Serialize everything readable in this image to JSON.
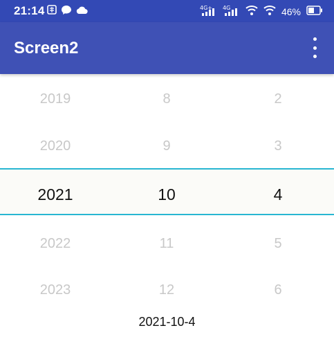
{
  "status_bar": {
    "time": "21:14",
    "network_1": "4G+",
    "network_2": "4G",
    "battery": "46%",
    "icons": [
      "notification-icon",
      "chat-bubble-icon",
      "cloud-icon",
      "signal-icon",
      "wifi-icon",
      "battery-icon"
    ]
  },
  "app_bar": {
    "title": "Screen2",
    "overflow_icon": "more-vert-icon",
    "color": "#3f51b5"
  },
  "picker": {
    "accent": "#28b6d2",
    "year": {
      "items": [
        "2019",
        "2020",
        "2021",
        "2022",
        "2023"
      ],
      "selected": "2021"
    },
    "month": {
      "items": [
        "8",
        "9",
        "10",
        "11",
        "12"
      ],
      "selected": "10"
    },
    "day": {
      "items": [
        "2",
        "3",
        "4",
        "5",
        "6"
      ],
      "selected": "4"
    }
  },
  "result": {
    "date_text": "2021-10-4"
  }
}
